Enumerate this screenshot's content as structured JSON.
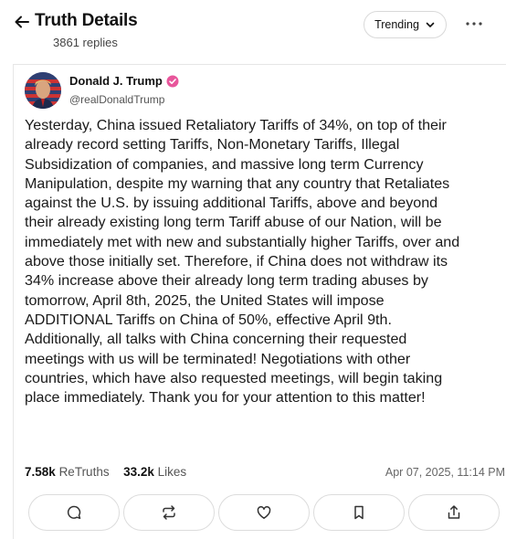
{
  "header": {
    "title": "Truth Details",
    "replies": "3861 replies",
    "sort_label": "Trending",
    "back_icon": "arrow-left-icon",
    "more_icon": "more-horizontal-icon"
  },
  "post": {
    "author_name": "Donald J. Trump",
    "author_handle": "@realDonaldTrump",
    "verified_color": "#e8569b",
    "text": "Yesterday, China issued Retaliatory Tariffs of 34%, on top of their\nalready record setting Tariffs, Non-Monetary Tariffs, Illegal\nSubsidization of companies, and massive long term Currency\nManipulation, despite my warning that any country that Retaliates\nagainst the U.S. by issuing additional Tariffs, above and beyond\ntheir already existing long term Tariff abuse of our Nation, will be\nimmediately met with new and substantially higher Tariffs, over and\nabove those initially set. Therefore, if China does not withdraw its\n34% increase above their already long term trading abuses by\ntomorrow, April 8th, 2025, the United States will impose\nADDITIONAL Tariffs on China of 50%, effective April 9th.\nAdditionally, all talks with China concerning their requested\nmeetings with us will be terminated! Negotiations with other\ncountries, which have also requested meetings, will begin taking\nplace immediately. Thank you for your attention to this matter!",
    "retruths_count": "7.58k",
    "retruths_label": "ReTruths",
    "likes_count": "33.2k",
    "likes_label": "Likes",
    "timestamp": "Apr 07, 2025, 11:14 PM"
  },
  "actions": [
    {
      "name": "reply",
      "icon": "comment-icon"
    },
    {
      "name": "retruth",
      "icon": "repost-icon"
    },
    {
      "name": "like",
      "icon": "heart-icon"
    },
    {
      "name": "bookmark",
      "icon": "bookmark-icon"
    },
    {
      "name": "share",
      "icon": "share-icon"
    }
  ]
}
